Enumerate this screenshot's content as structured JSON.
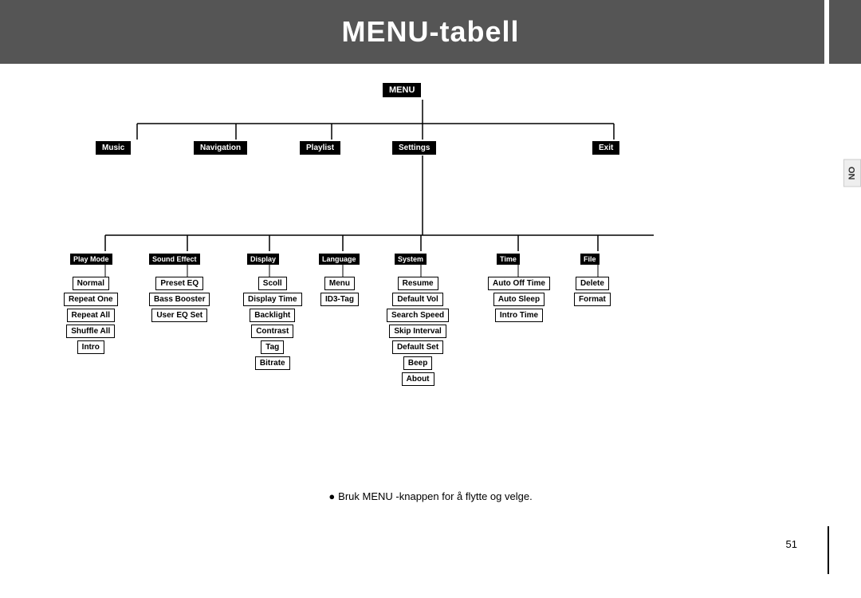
{
  "header": {
    "title": "MENU-tabell",
    "side_label": "NO"
  },
  "menu": {
    "root": "MENU",
    "level1": [
      "Music",
      "Navigation",
      "Playlist",
      "Settings",
      "Exit"
    ],
    "level2": [
      "Play Mode",
      "Sound Effect",
      "Display",
      "Language",
      "System",
      "Time",
      "File"
    ],
    "sub_play_mode": [
      "Normal",
      "Repeat One",
      "Repeat All",
      "Shuffle All",
      "Intro"
    ],
    "sub_sound_effect": [
      "Preset EQ",
      "Bass Booster",
      "User EQ Set"
    ],
    "sub_display": [
      "Scoll",
      "Display Time",
      "Backlight",
      "Contrast",
      "Tag",
      "Bitrate"
    ],
    "sub_language": [
      "Menu",
      "ID3-Tag"
    ],
    "sub_system": [
      "Resume",
      "Default Vol",
      "Search Speed",
      "Skip Interval",
      "Default Set",
      "Beep",
      "About"
    ],
    "sub_time": [
      "Auto Off Time",
      "Auto Sleep",
      "Intro Time"
    ],
    "sub_file": [
      "Delete",
      "Format"
    ]
  },
  "footer": {
    "text": "Bruk MENU -knappen for å flytte og velge.",
    "page": "51"
  }
}
